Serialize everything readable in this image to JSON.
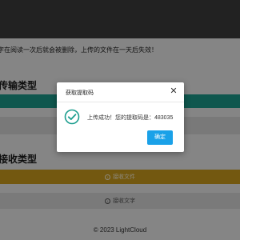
{
  "notice_text": "字在阅读一次后就会被删除，上传的文件在一天后失效！",
  "send_section_title": "传输类型",
  "receive_section_title": "接收类型",
  "receive_file_label": "接收文件",
  "receive_text_label": "接收文字",
  "footer_text": "© 2023 LightCloud",
  "dialog": {
    "title": "获取提取码",
    "close_icon": "close-icon",
    "message": "上传成功！您的提取码是：483035",
    "confirm_label": "确定"
  },
  "colors": {
    "topbar": "#3e3e3e",
    "teal": "#1d9e8f",
    "receive_file_bg": "#d1a11e",
    "confirm_button": "#1aa1e8",
    "success_icon": "#1d9e8f"
  },
  "icons": {
    "success": "check-circle-icon",
    "receive_file": "download-icon",
    "receive_text": "download-icon"
  }
}
